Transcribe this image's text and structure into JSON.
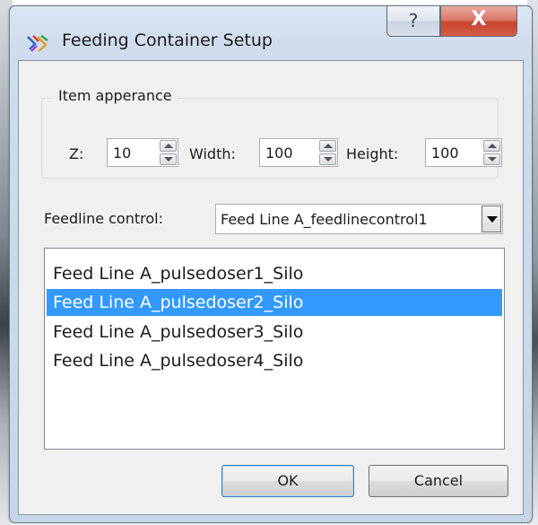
{
  "window": {
    "title": "Feeding Container Setup",
    "help_glyph": "?",
    "close_glyph": "X"
  },
  "appearance": {
    "group_label": "Item apperance",
    "z_label": "Z:",
    "z_value": "10",
    "width_label": "Width:",
    "width_value": "100",
    "height_label": "Height:",
    "height_value": "100"
  },
  "feedline": {
    "label": "Feedline control:",
    "selected": "Feed Line A_feedlinecontrol1"
  },
  "list": {
    "items": [
      "Feed Line A_pulsedoser1_Silo",
      "Feed Line A_pulsedoser2_Silo",
      "Feed Line A_pulsedoser3_Silo",
      "Feed Line A_pulsedoser4_Silo"
    ],
    "selected_index": 1
  },
  "buttons": {
    "ok": "OK",
    "cancel": "Cancel"
  },
  "colors": {
    "selection": "#3399ff",
    "close_button": "#c8452f",
    "window_frame": "#c6d5e8"
  }
}
